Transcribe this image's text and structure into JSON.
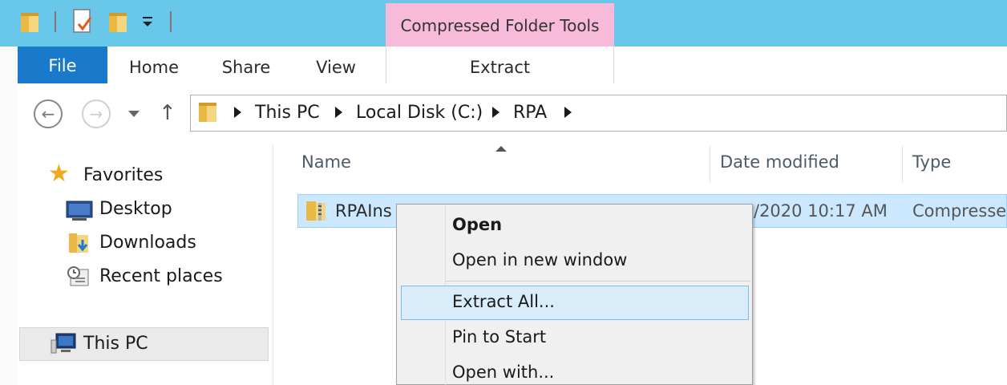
{
  "ribbon": {
    "file_tab": "File",
    "tabs": [
      "Home",
      "Share",
      "View"
    ],
    "contextual_header": "Compressed Folder Tools",
    "contextual_tab": "Extract"
  },
  "address": {
    "crumbs": [
      "This PC",
      "Local Disk (C:)",
      "RPA"
    ]
  },
  "nav_pane": {
    "favorites": "Favorites",
    "items": [
      "Desktop",
      "Downloads",
      "Recent places"
    ],
    "this_pc": "This PC"
  },
  "columns": {
    "name": "Name",
    "date_modified": "Date modified",
    "type": "Type"
  },
  "file": {
    "name": "RPAIns",
    "date_modified": "/2020 10:17 AM",
    "type": "Compresse"
  },
  "context_menu": {
    "items": [
      "Open",
      "Open in new window",
      "Extract All...",
      "Pin to Start",
      "Open with..."
    ],
    "highlighted_index": 2
  },
  "colors": {
    "title_bar": "#69c8e9",
    "file_tab": "#1979ca",
    "contextual_header": "#f7bbd9",
    "selection": "#cce8ff",
    "menu_highlight": "#d9ecfa"
  }
}
